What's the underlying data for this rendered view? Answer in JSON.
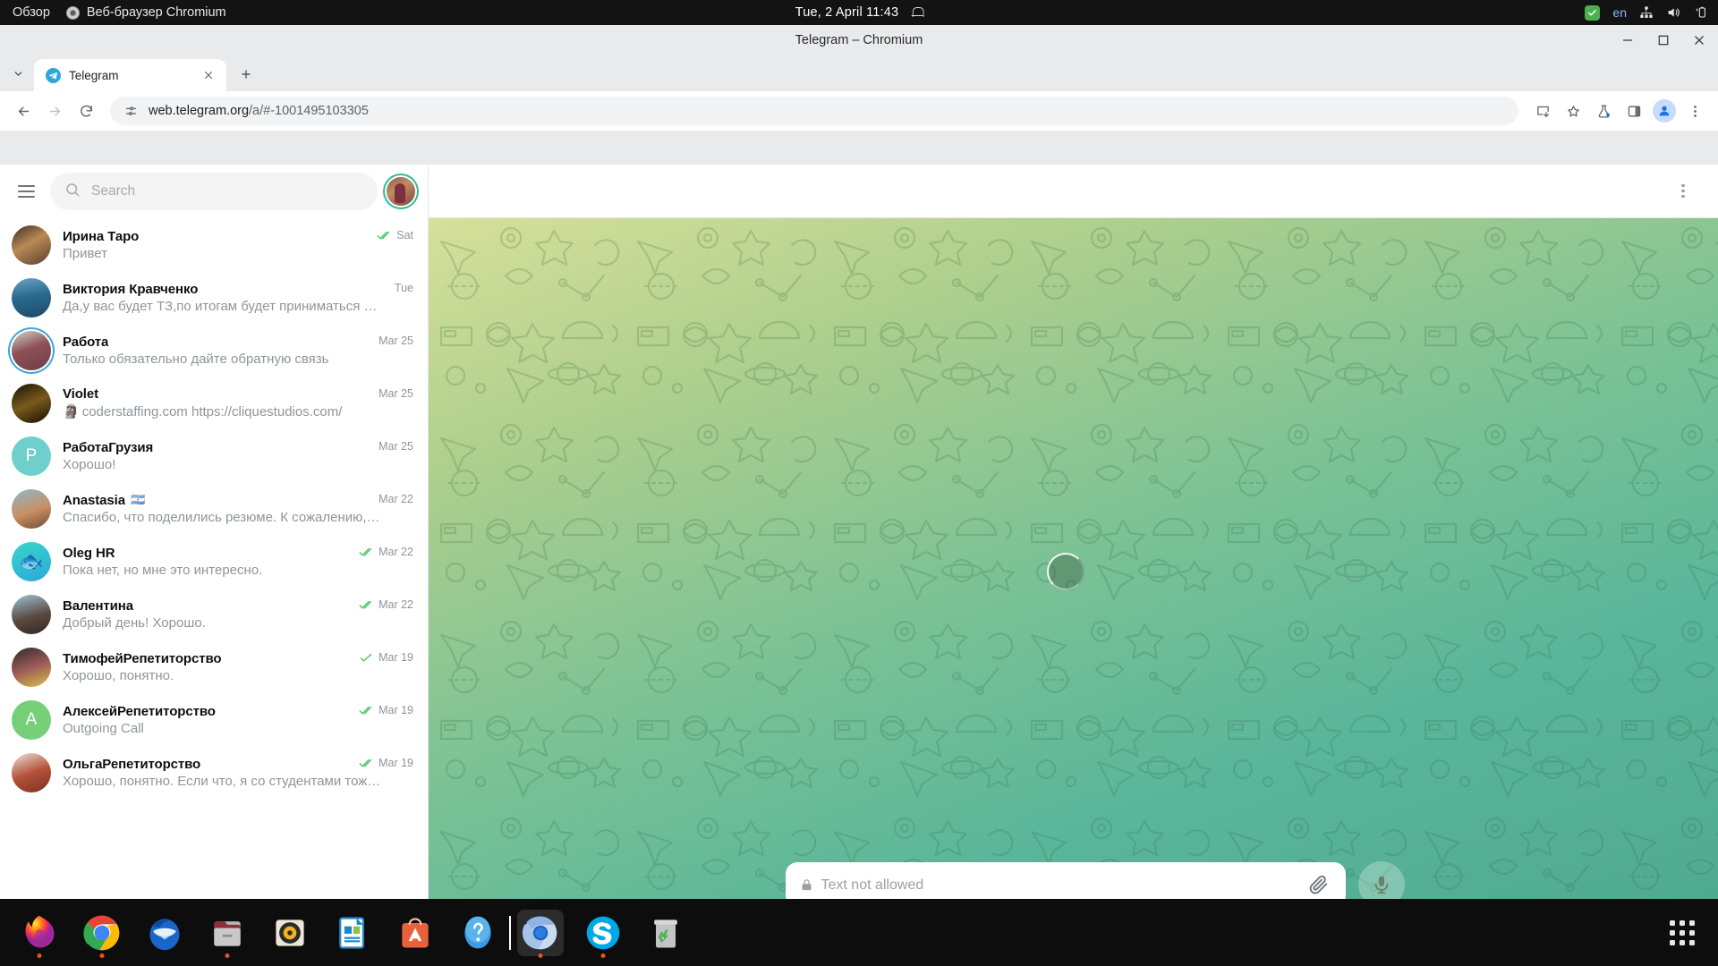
{
  "gnome": {
    "activities": "Обзор",
    "app_name": "Веб-браузер Chromium",
    "clock": "Tue, 2 April  11:43",
    "language": "en",
    "icons": [
      "shield-check-icon",
      "network-icon",
      "volume-icon",
      "battery-icon",
      "bell-icon"
    ]
  },
  "browser": {
    "window_title": "Telegram – Chromium",
    "tab": {
      "title": "Telegram",
      "favicon": "telegram-icon"
    },
    "new_tab_label": "+",
    "url": "web.telegram.org",
    "url_path": "/a/#-1001495103305",
    "toolbar_icons": [
      "back-icon",
      "forward-icon",
      "reload-icon",
      "install-icon",
      "bookmark-star-icon",
      "experiments-flask-icon",
      "side-panel-icon",
      "profile-avatar-icon",
      "chrome-menu-icon"
    ]
  },
  "telegram": {
    "search": {
      "placeholder": "Search"
    },
    "header_menu": "chat-menu-icon",
    "chats": [
      {
        "name": "Ирина Таро",
        "flag": "",
        "text": "Привет",
        "time": "Sat",
        "status": "double-check",
        "avatar": {
          "type": "photo",
          "bg": "linear-gradient(150deg,#3a2a22,#b98a55 45%,#5c3b2b)",
          "ring": false
        }
      },
      {
        "name": "Виктория Кравченко",
        "flag": "",
        "text": "Да,у вас будет ТЗ,по итогам будет приниматься …",
        "time": "Tue",
        "status": "none",
        "avatar": {
          "type": "photo",
          "bg": "linear-gradient(170deg,#6ba3c4 0%,#2b6a90 45%,#1d4a66 100%)",
          "ring": false
        }
      },
      {
        "name": "Работа",
        "flag": "",
        "text": "Только обязательно дайте обратную связь",
        "time": "Mar 25",
        "status": "none",
        "avatar": {
          "type": "photo",
          "bg": "linear-gradient(160deg,#cfd9cb 0%,#8f5058 45%,#6e3d44 100%)",
          "ring": true
        }
      },
      {
        "name": "Violet",
        "flag": "",
        "text": "coderstaffing.com https://cliquestudios.com/",
        "time": "Mar 25",
        "status": "none",
        "sender_icon": "🗿",
        "avatar": {
          "type": "photo",
          "bg": "linear-gradient(155deg,#161008 0%,#7a5a1c 50%,#120d06 100%)",
          "ring": false
        }
      },
      {
        "name": "РаботаГрузия",
        "flag": "",
        "text": "Хорошо!",
        "time": "Mar 25",
        "status": "none",
        "avatar": {
          "type": "letter",
          "letter": "Р",
          "bg": "#6fcfcb",
          "ring": false
        }
      },
      {
        "name": "Anastasia",
        "flag": "🇦🇷",
        "text": "Спасибо, что поделились резюме. К сожалению,…",
        "time": "Mar 22",
        "status": "none",
        "avatar": {
          "type": "photo",
          "bg": "linear-gradient(160deg,#8fb6cf 0%,#c98f63 55%,#6f4a33 100%)",
          "ring": false
        }
      },
      {
        "name": "Oleg HR",
        "flag": "",
        "text": "Пока нет, но мне это интересно.",
        "time": "Mar 22",
        "status": "double-check",
        "avatar": {
          "type": "emoji",
          "emoji": "🐟",
          "bg": "linear-gradient(160deg,#39d6c8,#2aa8dd)",
          "ring": false
        }
      },
      {
        "name": "Валентина",
        "flag": "",
        "text": "Добрый день! Хорошо.",
        "time": "Mar 22",
        "status": "double-check",
        "avatar": {
          "type": "photo",
          "bg": "linear-gradient(165deg,#9fc2d8 0%,#5b4a3e 55%,#2f2722 100%)",
          "ring": false
        }
      },
      {
        "name": "ТимофейРепетиторство",
        "flag": "",
        "text": "Хорошо, понятно.",
        "time": "Mar 19",
        "status": "single-check",
        "avatar": {
          "type": "photo",
          "bg": "linear-gradient(160deg,#2e2b28 0%,#9b5a57 50%,#d9c24a 100%)",
          "ring": false
        }
      },
      {
        "name": "АлексейРепетиторство",
        "flag": "",
        "text": "Outgoing Call",
        "time": "Mar 19",
        "status": "double-check",
        "avatar": {
          "type": "letter",
          "letter": "А",
          "bg": "#76d07a",
          "ring": false
        }
      },
      {
        "name": "ОльгаРепетиторство",
        "flag": "",
        "text": "Хорошо, понятно. Если что, я со студентами тож…",
        "time": "Mar 19",
        "status": "double-check",
        "avatar": {
          "type": "photo",
          "bg": "linear-gradient(160deg,#efe4dc 0%,#b4543a 50%,#7d2f22 100%)",
          "ring": false
        }
      }
    ],
    "composer": {
      "placeholder": "Text not allowed",
      "lock_icon": "lock-icon",
      "attach_icon": "paperclip-icon",
      "mic_icon": "microphone-icon"
    }
  },
  "taskbar": {
    "apps": [
      {
        "name": "firefox",
        "running": true
      },
      {
        "name": "chrome",
        "running": true
      },
      {
        "name": "thunderbird",
        "running": false
      },
      {
        "name": "files",
        "running": true
      },
      {
        "name": "rhythmbox",
        "running": false
      },
      {
        "name": "libreoffice",
        "running": false
      },
      {
        "name": "ubuntu-software",
        "running": false
      },
      {
        "name": "help",
        "running": false
      },
      {
        "name": "chromium",
        "running": true,
        "active": true
      },
      {
        "name": "skype",
        "running": true
      },
      {
        "name": "trash",
        "running": false
      }
    ],
    "show_apps": "show-applications-icon"
  }
}
